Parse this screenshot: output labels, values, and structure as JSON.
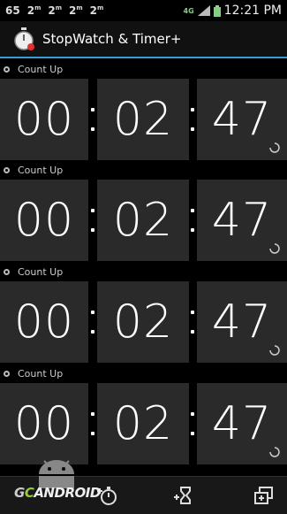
{
  "status_bar": {
    "left_items": [
      "65",
      "2",
      "2",
      "2",
      "2"
    ],
    "network": "4G",
    "time": "12:21 PM"
  },
  "app": {
    "title": "StopWatch & Timer+"
  },
  "timers": [
    {
      "label": "Count Up",
      "hours": "00",
      "minutes": "02",
      "seconds": "47"
    },
    {
      "label": "Count Up",
      "hours": "00",
      "minutes": "02",
      "seconds": "47"
    },
    {
      "label": "Count Up",
      "hours": "00",
      "minutes": "02",
      "seconds": "47"
    },
    {
      "label": "Count Up",
      "hours": "00",
      "minutes": "02",
      "seconds": "47"
    }
  ],
  "bottom_bar": {
    "buttons": [
      "add-stopwatch-icon",
      "add-timer-icon",
      "copy-icon"
    ]
  },
  "watermark": {
    "text": "ANDROID"
  },
  "colors": {
    "accent": "#3a9bd8",
    "cell_bg": "#2a2a2a",
    "background": "#000000"
  }
}
